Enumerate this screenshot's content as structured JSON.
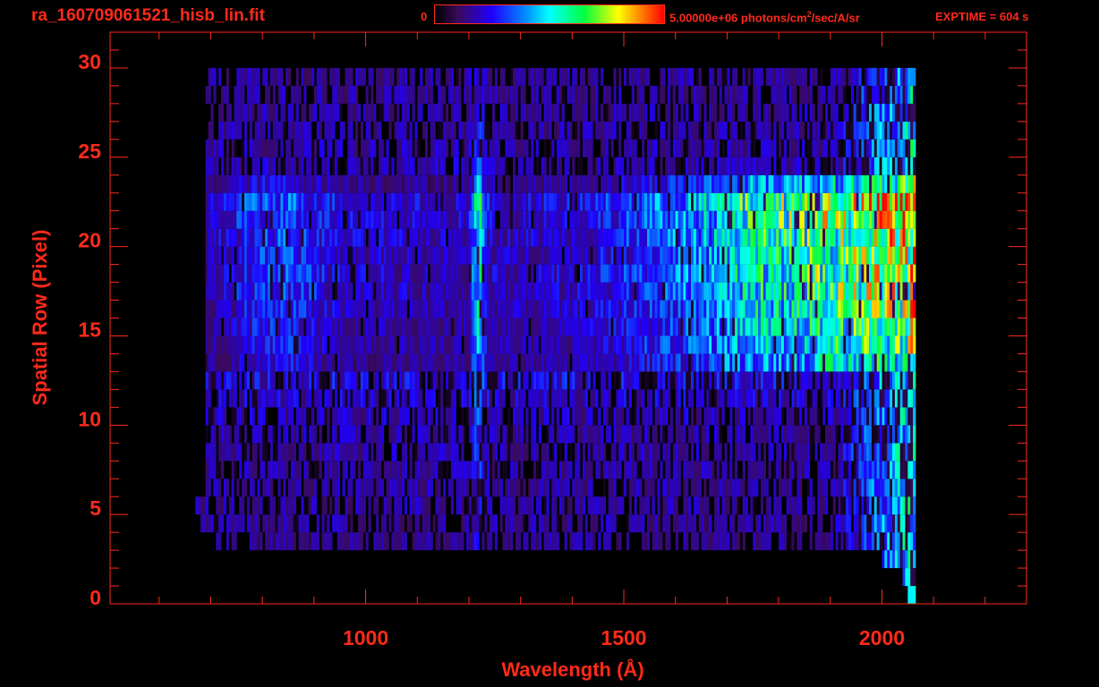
{
  "title": "ra_160709061521_hisb_lin.fit",
  "colorbar": {
    "min_label": "0",
    "max_label": "5.00000e+06 photons/cm",
    "unit_sup": "2",
    "unit_rest": "/sec/A/sr"
  },
  "exptime": "EXPTIME = 604 s",
  "colors": {
    "axis": "#ff2a1a",
    "background": "#000000"
  },
  "chart_data": {
    "type": "heatmap",
    "title": "ra_160709061521_hisb_lin.fit",
    "xlabel": "Wavelength (Å)",
    "ylabel": "Spatial Row (Pixel)",
    "xlim": [
      505,
      2280
    ],
    "ylim": [
      0,
      32
    ],
    "x_ticks": [
      1000,
      1500,
      2000
    ],
    "x_tick_labels": [
      "1000",
      "1500",
      "2000"
    ],
    "y_ticks": [
      0,
      5,
      10,
      15,
      20,
      25,
      30
    ],
    "y_tick_labels": [
      "0",
      "5",
      "10",
      "15",
      "20",
      "25",
      "30"
    ],
    "zlim": [
      0,
      5000000
    ],
    "colormap_stops": [
      [
        0,
        "#000000"
      ],
      [
        0.1,
        "#3a0a5a"
      ],
      [
        0.25,
        "#2000ff"
      ],
      [
        0.4,
        "#0090ff"
      ],
      [
        0.5,
        "#00ffff"
      ],
      [
        0.65,
        "#00ff40"
      ],
      [
        0.8,
        "#ffff00"
      ],
      [
        0.9,
        "#ff8000"
      ],
      [
        1,
        "#ff0000"
      ]
    ],
    "wavelength_step": 5,
    "rows": [
      {
        "row": 0,
        "start": 2050,
        "end": 2065,
        "scale": 0.05
      },
      {
        "row": 1,
        "start": 2040,
        "end": 2065,
        "scale": 0.08
      },
      {
        "row": 2,
        "start": 2000,
        "end": 2065,
        "scale": 0.1
      },
      {
        "row": 3,
        "start": 710,
        "end": 2065,
        "scale": 0.12
      },
      {
        "row": 4,
        "start": 680,
        "end": 2065,
        "scale": 0.15
      },
      {
        "row": 5,
        "start": 670,
        "end": 2065,
        "scale": 0.16
      },
      {
        "row": 6,
        "start": 690,
        "end": 2065,
        "scale": 0.18
      },
      {
        "row": 7,
        "start": 690,
        "end": 2065,
        "scale": 0.18
      },
      {
        "row": 8,
        "start": 690,
        "end": 2065,
        "scale": 0.2
      },
      {
        "row": 9,
        "start": 690,
        "end": 2065,
        "scale": 0.22
      },
      {
        "row": 10,
        "start": 690,
        "end": 2065,
        "scale": 0.25
      },
      {
        "row": 11,
        "start": 690,
        "end": 2065,
        "scale": 0.3
      },
      {
        "row": 12,
        "start": 690,
        "end": 2065,
        "scale": 0.4
      },
      {
        "row": 13,
        "start": 690,
        "end": 2065,
        "scale": 0.75
      },
      {
        "row": 14,
        "start": 690,
        "end": 2065,
        "scale": 0.85
      },
      {
        "row": 15,
        "start": 690,
        "end": 2065,
        "scale": 0.85
      },
      {
        "row": 16,
        "start": 690,
        "end": 2065,
        "scale": 0.9
      },
      {
        "row": 17,
        "start": 690,
        "end": 2065,
        "scale": 0.95
      },
      {
        "row": 18,
        "start": 690,
        "end": 2065,
        "scale": 1.0
      },
      {
        "row": 19,
        "start": 690,
        "end": 2065,
        "scale": 0.95
      },
      {
        "row": 20,
        "start": 690,
        "end": 2065,
        "scale": 1.0
      },
      {
        "row": 21,
        "start": 690,
        "end": 2065,
        "scale": 1.05
      },
      {
        "row": 22,
        "start": 690,
        "end": 2065,
        "scale": 1.1
      },
      {
        "row": 23,
        "start": 690,
        "end": 2065,
        "scale": 0.75
      },
      {
        "row": 24,
        "start": 690,
        "end": 2065,
        "scale": 0.25
      },
      {
        "row": 25,
        "start": 690,
        "end": 2065,
        "scale": 0.2
      },
      {
        "row": 26,
        "start": 690,
        "end": 2065,
        "scale": 0.18
      },
      {
        "row": 27,
        "start": 690,
        "end": 2065,
        "scale": 0.17
      },
      {
        "row": 28,
        "start": 690,
        "end": 2065,
        "scale": 0.16
      },
      {
        "row": 29,
        "start": 690,
        "end": 2065,
        "scale": 0.15
      }
    ],
    "spectrum_profile": [
      [
        690,
        0.18
      ],
      [
        780,
        0.3
      ],
      [
        850,
        0.32
      ],
      [
        950,
        0.22
      ],
      [
        1150,
        0.2
      ],
      [
        1400,
        0.22
      ],
      [
        1550,
        0.32
      ],
      [
        1650,
        0.42
      ],
      [
        1750,
        0.55
      ],
      [
        1850,
        0.62
      ],
      [
        1950,
        0.7
      ],
      [
        2040,
        0.78
      ],
      [
        2065,
        0.9
      ]
    ],
    "emission_lines": [
      {
        "wavelength": 1216,
        "width": 12,
        "strength": 0.35
      }
    ],
    "background_level": 0.12
  }
}
